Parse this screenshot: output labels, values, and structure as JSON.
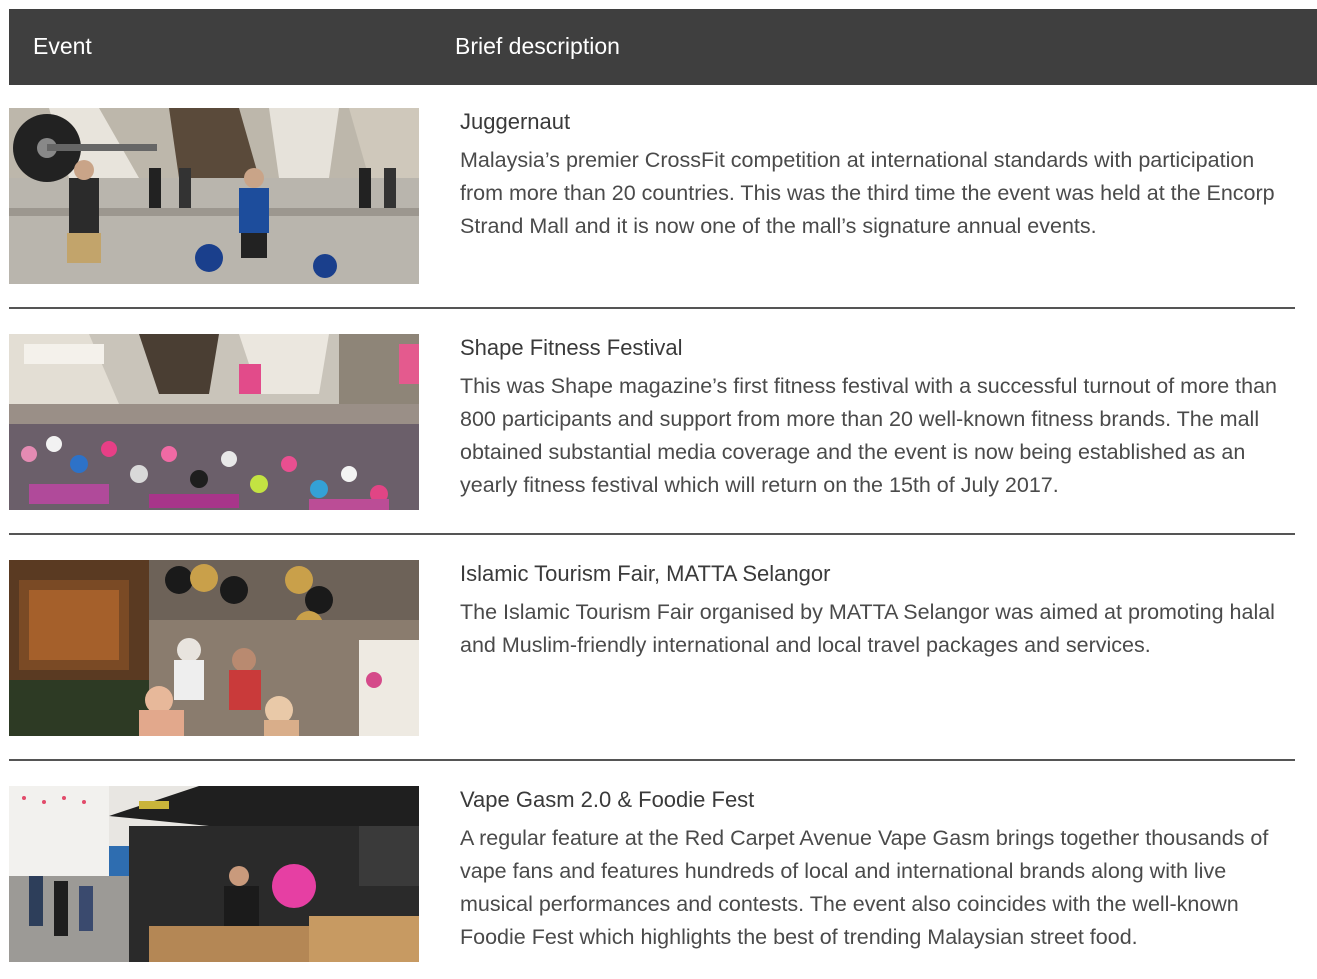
{
  "header": {
    "col_event": "Event",
    "col_description": "Brief description"
  },
  "events": [
    {
      "title": "Juggernaut",
      "description": "Malaysia’s premier CrossFit competition at international standards with participation from more than 20 countries. This was the third time the event was held at the Encorp Strand Mall and it is now one of the mall’s signature annual events."
    },
    {
      "title": "Shape Fitness Festival",
      "description": "This was Shape magazine’s first fitness festival with a successful turnout of more than 800 participants and support from more than 20 well-known fitness brands. The mall obtained substantial media coverage and the event is now being established as an yearly fitness festival which  will return on the 15th of July 2017."
    },
    {
      "title": "Islamic Tourism Fair, MATTA Selangor",
      "description": "The Islamic Tourism Fair organised by MATTA Selangor was aimed at promoting halal and Muslim-friendly international and local travel packages and services."
    },
    {
      "title": "Vape Gasm 2.0 & Foodie Fest",
      "description": "A regular feature at the Red Carpet Avenue Vape Gasm brings together thousands of vape fans and features hundreds of local and international brands along with live musical performances and contests. The event also coincides with the well-known Foodie Fest which highlights the best of trending Malaysian street food."
    }
  ]
}
